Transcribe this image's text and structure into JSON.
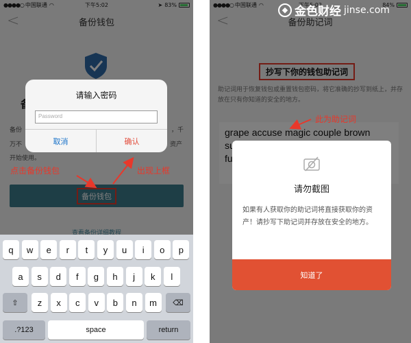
{
  "left_phone": {
    "status": {
      "carrier": "中国联通",
      "signal": "●●●●○",
      "time": "下午5:02",
      "battery": "83%"
    },
    "nav_title": "备份钱包",
    "bg_heading": "备",
    "bg_desc_lines": [
      "备份",
      "万不",
      "开始使用。"
    ],
    "bg_desc_right": [
      "，千",
      "资产"
    ],
    "backup_button": "备份钱包",
    "tutorial_link": "查看备份详细教程",
    "alert": {
      "title": "请输入密码",
      "password_placeholder": "Password",
      "cancel": "取消",
      "confirm": "确认"
    },
    "annotations": {
      "click_backup": "点击备份钱包",
      "popup_appears": "出现上框"
    },
    "keyboard": {
      "row1": [
        "q",
        "w",
        "e",
        "r",
        "t",
        "y",
        "u",
        "i",
        "o",
        "p"
      ],
      "row2": [
        "a",
        "s",
        "d",
        "f",
        "g",
        "h",
        "j",
        "k",
        "l"
      ],
      "row3": [
        "z",
        "x",
        "c",
        "v",
        "b",
        "n",
        "m"
      ],
      "numbers": ".?123",
      "space": "space",
      "return": "return",
      "shift_icon": "shift-icon",
      "delete_icon": "delete-icon"
    }
  },
  "right_phone": {
    "status": {
      "carrier": "中国联通",
      "signal": "●●●●○",
      "time": "下午5:02",
      "battery": "84%"
    },
    "logo": {
      "text": "金色财经",
      "site": "jinse.com"
    },
    "nav_title": "备份助记词",
    "red_title": "抄写下你的钱包助记词",
    "description": "助记词用于恢复钱包或重置钱包密码，将它准确的抄写到纸上，并存放在只有你知道的安全的地方。",
    "mnemonic_lines": [
      "grape accuse magic couple brown",
      "su",
      "fu"
    ],
    "annotation": "此为助记词",
    "modal": {
      "icon": "no-camera-icon",
      "title": "请勿截图",
      "body": "如果有人获取你的助记词将直接获取你的资产！请抄写下助记词并存放在安全的地方。",
      "button": "知道了"
    }
  },
  "colors": {
    "accent_teal": "#3d7c8c",
    "annotation_red": "#e8382b",
    "modal_button": "#e15133",
    "link_blue": "#1a73c9"
  }
}
